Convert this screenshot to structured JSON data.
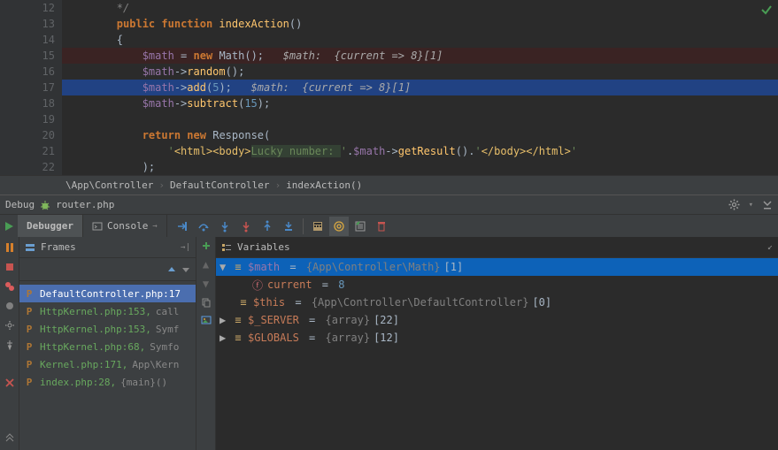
{
  "editor": {
    "line_numbers": [
      12,
      13,
      14,
      15,
      16,
      17,
      18,
      19,
      20,
      21,
      22
    ],
    "lines": {
      "l12": {
        "indent": "        ",
        "cmt": "*/"
      },
      "l13": {
        "indent": "        ",
        "kw1": "public",
        "kw2": "function",
        "fn": "indexAction",
        "paren": "()"
      },
      "l14": {
        "indent": "        ",
        "brace": "{"
      },
      "l15": {
        "indent": "            ",
        "var": "$math",
        "eq": " = ",
        "kw": "new",
        "cls": "Math",
        "tail": "();   ",
        "hint": "$math:  {current => 8}[1]"
      },
      "l16": {
        "indent": "            ",
        "var": "$math",
        "arrow": "->",
        "method": "random",
        "tail": "();"
      },
      "l17": {
        "indent": "            ",
        "var": "$math",
        "arrow": "->",
        "method": "add",
        "open": "(",
        "num": "5",
        "close": ");   ",
        "hint": "$math:  {current => 8}[1]"
      },
      "l18": {
        "indent": "            ",
        "var": "$math",
        "arrow": "->",
        "method": "subtract",
        "open": "(",
        "num": "15",
        "close": ");"
      },
      "l20": {
        "indent": "            ",
        "kw1": "return",
        "kw2": "new",
        "cls": "Response",
        "tail": "("
      },
      "l21": {
        "indent": "                ",
        "s1": "'",
        "t1": "<html>",
        "t2": "<body>",
        "hl": "Lucky number: ",
        "s2": "'",
        "dot": ".",
        "var": "$math",
        "arrow": "->",
        "method": "getResult",
        "call": "().",
        "s3": "'",
        "t3": "</body>",
        "t4": "</html>",
        "s4": "'"
      },
      "l22": {
        "indent": "            ",
        "close": ");"
      }
    }
  },
  "breadcrumb": {
    "a": "\\App\\Controller",
    "b": "DefaultController",
    "c": "indexAction()"
  },
  "debug": {
    "title": "Debug",
    "target": "router.php"
  },
  "tabs": {
    "debugger": "Debugger",
    "console": "Console"
  },
  "panels": {
    "frames": "Frames",
    "variables": "Variables"
  },
  "frames": [
    {
      "file": "DefaultController.php",
      "line": "17",
      "meta": ""
    },
    {
      "file": "HttpKernel.php",
      "line": "153",
      "meta": "call"
    },
    {
      "file": "HttpKernel.php",
      "line": "153",
      "meta": "Symf"
    },
    {
      "file": "HttpKernel.php",
      "line": "68",
      "meta": "Symfo"
    },
    {
      "file": "Kernel.php",
      "line": "171",
      "meta": "App\\Kern"
    },
    {
      "file": "index.php",
      "line": "28",
      "meta": "{main}()"
    }
  ],
  "variables": {
    "math": {
      "name": "$math",
      "eq": " = ",
      "type": "{App\\Controller\\Math}",
      "idx": "[1]"
    },
    "current": {
      "name": "current",
      "eq": " = ",
      "val": "8"
    },
    "this": {
      "name": "$this",
      "eq": " = ",
      "type": "{App\\Controller\\DefaultController}",
      "idx": "[0]"
    },
    "server": {
      "name": "$_SERVER",
      "eq": " = ",
      "type": "{array}",
      "idx": "[22]"
    },
    "globals": {
      "name": "$GLOBALS",
      "eq": " = ",
      "type": "{array}",
      "idx": "[12]"
    }
  },
  "icons": {
    "bug": "bug-icon",
    "gear": "gear-icon",
    "minimize": "minimize-icon",
    "play": "play-icon",
    "pause": "pause-icon",
    "stop": "stop-icon",
    "step_over": "step-over-icon",
    "step_into": "step-into-icon",
    "force_step_into": "force-step-into-icon",
    "step_out": "step-out-icon",
    "run_to_cursor": "run-to-cursor-icon",
    "evaluate": "evaluate-icon",
    "frames": "frames-icon",
    "variables": "variables-icon",
    "thread": "thread-icon",
    "show_ex": "show-execution-point-icon",
    "drop_frame": "drop-frame-icon",
    "mute_bp": "mute-breakpoints-icon",
    "view_bp": "view-breakpoints-icon",
    "checkmark": "checkmark-icon",
    "bp": "breakpoint-icon",
    "collapse": "collapse-icon",
    "arrow_up": "arrow-up-icon",
    "arrow_down": "arrow-down-icon",
    "hide": "hide-icon",
    "restore": "restore-icon"
  }
}
